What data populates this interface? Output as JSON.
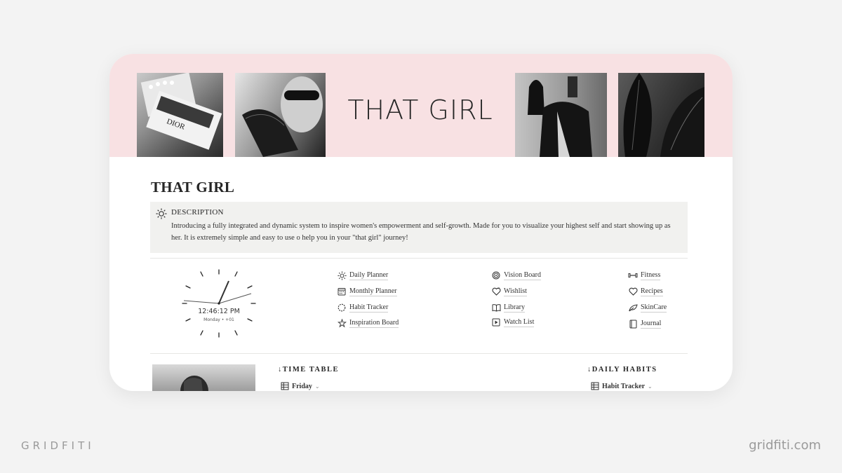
{
  "banner": {
    "title": "THAT GIRL",
    "bg_color": "#f8e1e3",
    "photo_text": "DIOR"
  },
  "page": {
    "title": "THAT GIRL"
  },
  "callout": {
    "icon": "sun-icon",
    "heading": "DESCRIPTION",
    "text": "Introducing a fully integrated and dynamic system to inspire women's empowerment and self-growth. Made for you to visualize your highest self and start showing up as her. It is extremely simple and easy to use o help you in your \"that girl\" journey!"
  },
  "clock": {
    "time": "12:46:12 PM",
    "date": "Monday • +01"
  },
  "links": {
    "col1": [
      {
        "label": "Daily Planner",
        "icon": "sun-icon"
      },
      {
        "label": "Monthly Planner",
        "icon": "calendar-icon"
      },
      {
        "label": "Habit Tracker",
        "icon": "progress-circle-icon"
      },
      {
        "label": "Inspiration Board",
        "icon": "sparkle-icon"
      }
    ],
    "col2": [
      {
        "label": "Vision Board",
        "icon": "target-icon"
      },
      {
        "label": "Wishlist",
        "icon": "heart-icon"
      },
      {
        "label": "Library",
        "icon": "book-icon"
      },
      {
        "label": "Watch List",
        "icon": "play-icon"
      }
    ],
    "col3": [
      {
        "label": "Fitness",
        "icon": "dumbbell-icon"
      },
      {
        "label": "Recipes",
        "icon": "heart-outline-icon"
      },
      {
        "label": "SkinCare",
        "icon": "leaf-icon"
      },
      {
        "label": "Journal",
        "icon": "notebook-icon"
      }
    ]
  },
  "timetable": {
    "heading": "↓TIME TABLE",
    "view_label": "Friday"
  },
  "habits": {
    "heading": "↓DAILY HABITS",
    "view_label": "Habit Tracker"
  },
  "watermark": {
    "left": "GRIDFITI",
    "right": "gridfiti.com"
  }
}
